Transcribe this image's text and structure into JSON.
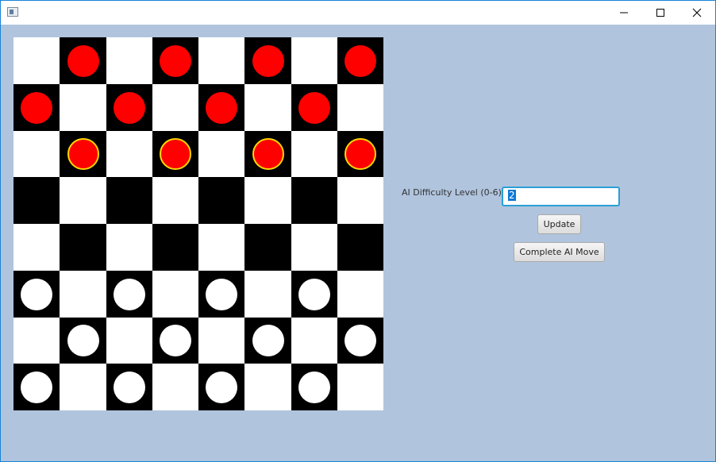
{
  "window": {
    "title": "",
    "icon": "app-window-icon",
    "controls": {
      "minimize_icon": "minimize-icon",
      "maximize_icon": "maximize-icon",
      "close_icon": "close-icon"
    }
  },
  "board": {
    "rows": 8,
    "cols": 8,
    "colors": {
      "light_square": "#ffffff",
      "dark_square": "#000000",
      "red_piece": "#ff0000",
      "white_piece": "#ffffff",
      "movable_highlight": "#ffd700"
    },
    "pieces": [
      {
        "row": 0,
        "col": 1,
        "color": "red",
        "movable": false
      },
      {
        "row": 0,
        "col": 3,
        "color": "red",
        "movable": false
      },
      {
        "row": 0,
        "col": 5,
        "color": "red",
        "movable": false
      },
      {
        "row": 0,
        "col": 7,
        "color": "red",
        "movable": false
      },
      {
        "row": 1,
        "col": 0,
        "color": "red",
        "movable": false
      },
      {
        "row": 1,
        "col": 2,
        "color": "red",
        "movable": false
      },
      {
        "row": 1,
        "col": 4,
        "color": "red",
        "movable": false
      },
      {
        "row": 1,
        "col": 6,
        "color": "red",
        "movable": false
      },
      {
        "row": 2,
        "col": 1,
        "color": "red",
        "movable": true
      },
      {
        "row": 2,
        "col": 3,
        "color": "red",
        "movable": true
      },
      {
        "row": 2,
        "col": 5,
        "color": "red",
        "movable": true
      },
      {
        "row": 2,
        "col": 7,
        "color": "red",
        "movable": true
      },
      {
        "row": 5,
        "col": 0,
        "color": "white",
        "movable": false
      },
      {
        "row": 5,
        "col": 2,
        "color": "white",
        "movable": false
      },
      {
        "row": 5,
        "col": 4,
        "color": "white",
        "movable": false
      },
      {
        "row": 5,
        "col": 6,
        "color": "white",
        "movable": false
      },
      {
        "row": 6,
        "col": 1,
        "color": "white",
        "movable": false
      },
      {
        "row": 6,
        "col": 3,
        "color": "white",
        "movable": false
      },
      {
        "row": 6,
        "col": 5,
        "color": "white",
        "movable": false
      },
      {
        "row": 6,
        "col": 7,
        "color": "white",
        "movable": false
      },
      {
        "row": 7,
        "col": 0,
        "color": "white",
        "movable": false
      },
      {
        "row": 7,
        "col": 2,
        "color": "white",
        "movable": false
      },
      {
        "row": 7,
        "col": 4,
        "color": "white",
        "movable": false
      },
      {
        "row": 7,
        "col": 6,
        "color": "white",
        "movable": false
      }
    ]
  },
  "controls": {
    "difficulty_label": "AI Difficulty Level (0-6):",
    "difficulty_value": "2",
    "update_label": "Update",
    "ai_move_label": "Complete AI Move"
  },
  "colors": {
    "background": "#b0c4de",
    "input_focus_border": "#2a9fd6",
    "text_selection": "#0b78d7"
  }
}
